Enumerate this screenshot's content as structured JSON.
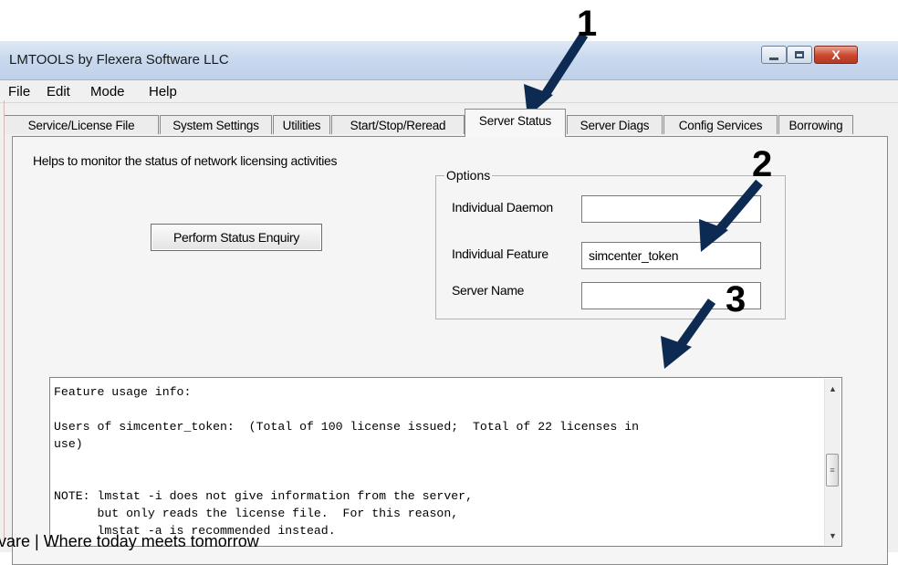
{
  "window": {
    "title": "LMTOOLS by Flexera Software LLC",
    "close_label": "X"
  },
  "menu": [
    "File",
    "Edit",
    "Mode",
    "Help"
  ],
  "tabs": [
    {
      "label": "Service/License File"
    },
    {
      "label": "System Settings"
    },
    {
      "label": "Utilities"
    },
    {
      "label": "Start/Stop/Reread"
    },
    {
      "label": "Server Status",
      "active": true
    },
    {
      "label": "Server Diags"
    },
    {
      "label": "Config Services"
    },
    {
      "label": "Borrowing"
    }
  ],
  "panel": {
    "description": "Helps to monitor the status of network licensing activities",
    "enquiry_button": "Perform Status Enquiry",
    "options": {
      "legend": "Options",
      "individual_daemon_label": "Individual Daemon",
      "individual_daemon_value": "",
      "individual_feature_label": "Individual Feature",
      "individual_feature_value": "simcenter_token",
      "server_name_label": "Server Name",
      "server_name_value": ""
    },
    "output_text": "Feature usage info:\n\nUsers of simcenter_token:  (Total of 100 license issued;  Total of 22 licenses in\nuse)\n\n\nNOTE: lmstat -i does not give information from the server,\n      but only reads the license file.  For this reason,\n      lmstat -a is recommended instead."
  },
  "annotations": {
    "step1": "1",
    "step2": "2",
    "step3": "3",
    "arrow_color": "#0d2b52"
  },
  "footer_text": "vare | Where today meets tomorrow"
}
